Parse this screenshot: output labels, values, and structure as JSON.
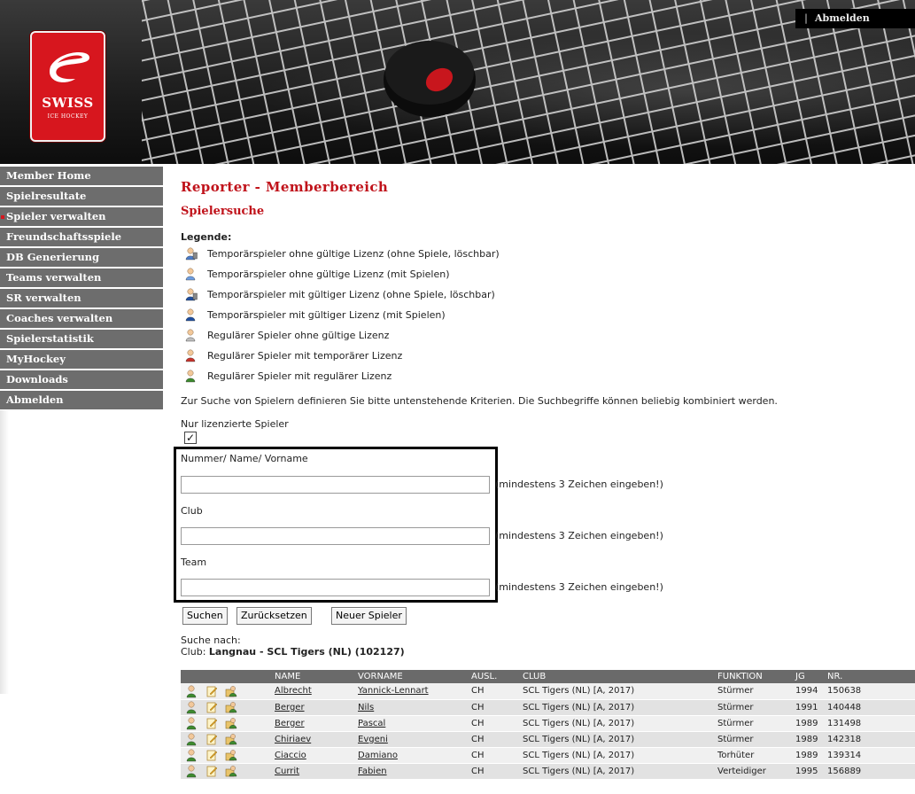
{
  "header": {
    "logout_label": "Abmelden",
    "logo": {
      "line1": "SWISS",
      "line2": "ICE HOCKEY"
    }
  },
  "sidebar": {
    "items": [
      {
        "label": "Member Home"
      },
      {
        "label": "Spielresultate"
      },
      {
        "label": "Spieler verwalten",
        "active": true
      },
      {
        "label": "Freundschaftsspiele"
      },
      {
        "label": "DB Generierung"
      },
      {
        "label": "Teams verwalten"
      },
      {
        "label": "SR verwalten"
      },
      {
        "label": "Coaches verwalten"
      },
      {
        "label": "Spielerstatistik"
      },
      {
        "label": "MyHockey"
      },
      {
        "label": "Downloads"
      },
      {
        "label": "Abmelden"
      }
    ]
  },
  "main": {
    "title": "Reporter - Memberbereich",
    "subtitle": "Spielersuche",
    "legend_title": "Legende:",
    "legend": [
      {
        "icon": "temp-player-trash-icon",
        "color": "#4a7bc8",
        "text": "Temporärspieler ohne gültige Lizenz (ohne Spiele, löschbar)"
      },
      {
        "icon": "temp-player-icon",
        "color": "#6d9de0",
        "text": "Temporärspieler ohne gültige Lizenz (mit Spielen)"
      },
      {
        "icon": "temp-player-trash-icon",
        "color": "#1f4fa0",
        "text": "Temporärspieler mit gültiger Lizenz (ohne Spiele, löschbar)"
      },
      {
        "icon": "temp-player-icon",
        "color": "#1f4fa0",
        "text": "Temporärspieler mit gültiger Lizenz (mit Spielen)"
      },
      {
        "icon": "player-icon",
        "color": "#bdbdbd",
        "text": "Regulärer Spieler ohne gültige Lizenz"
      },
      {
        "icon": "player-icon",
        "color": "#c8322b",
        "text": "Regulärer Spieler mit temporärer Lizenz"
      },
      {
        "icon": "player-icon",
        "color": "#3d8a2e",
        "text": "Regulärer Spieler mit regulärer Lizenz"
      }
    ],
    "intro": "Zur Suche von Spielern definieren Sie bitte untenstehende Kriterien. Die Suchbegriffe können beliebig kombiniert werden.",
    "licensed_only_label": "Nur lizenzierte Spieler",
    "licensed_only_checked": true,
    "fields": [
      {
        "label": "Nummer/ Name/ Vorname",
        "value": "",
        "hint": "(mindestens 3 Zeichen eingeben!)"
      },
      {
        "label": "Club",
        "value": "",
        "hint": "(mindestens 3 Zeichen eingeben!)"
      },
      {
        "label": "Team",
        "value": "",
        "hint": "(mindestens 3 Zeichen eingeben!)"
      }
    ],
    "buttons": {
      "search": "Suchen",
      "reset": "Zurücksetzen",
      "new_player": "Neuer Spieler"
    },
    "search_for_label": "Suche nach:",
    "search_for_club_prefix": "Club: ",
    "search_for_club_value": "Langnau - SCL Tigers (NL) (102127)"
  },
  "table": {
    "columns": [
      "NAME",
      "VORNAME",
      "AUSL.",
      "CLUB",
      "FUNKTION",
      "JG",
      "NR."
    ],
    "rows": [
      {
        "name": "Albrecht",
        "vorname": "Yannick-Lennart",
        "ausl": "CH",
        "club": "SCL Tigers (NL) [A, 2017)",
        "funktion": "Stürmer",
        "jg": "1994",
        "nr": "150638"
      },
      {
        "name": "Berger",
        "vorname": "Nils",
        "ausl": "CH",
        "club": "SCL Tigers (NL) [A, 2017)",
        "funktion": "Stürmer",
        "jg": "1991",
        "nr": "140448"
      },
      {
        "name": "Berger",
        "vorname": "Pascal",
        "ausl": "CH",
        "club": "SCL Tigers (NL) [A, 2017)",
        "funktion": "Stürmer",
        "jg": "1989",
        "nr": "131498"
      },
      {
        "name": "Chiriaev",
        "vorname": "Evgeni",
        "ausl": "CH",
        "club": "SCL Tigers (NL) [A, 2017)",
        "funktion": "Stürmer",
        "jg": "1989",
        "nr": "142318"
      },
      {
        "name": "Ciaccio",
        "vorname": "Damiano",
        "ausl": "CH",
        "club": "SCL Tigers (NL) [A, 2017)",
        "funktion": "Torhüter",
        "jg": "1989",
        "nr": "139314"
      },
      {
        "name": "Currit",
        "vorname": "Fabien",
        "ausl": "CH",
        "club": "SCL Tigers (NL) [A, 2017)",
        "funktion": "Verteidiger",
        "jg": "1995",
        "nr": "156889"
      }
    ]
  },
  "colors": {
    "accent_red": "#c0121a",
    "nav_grey": "#6d6d6d",
    "player_green": "#3d8a2e"
  }
}
